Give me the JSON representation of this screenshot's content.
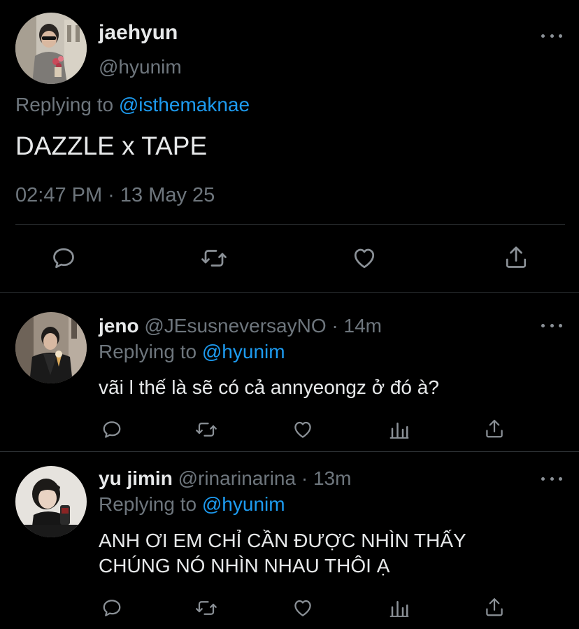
{
  "main_tweet": {
    "display_name": "jaehyun",
    "handle": "@hyunim",
    "replying_prefix": "Replying to",
    "replying_to": "@isthemaknae",
    "text": "DAZZLE x TAPE",
    "timestamp": "02:47 PM · 13 May 25",
    "actions": [
      "reply-icon",
      "retweet-icon",
      "like-icon",
      "share-icon"
    ]
  },
  "replies": [
    {
      "display_name": "jeno",
      "handle": "@JEsusneversayNO",
      "time": "· 14m",
      "replying_prefix": "Replying to",
      "replying_to": "@hyunim",
      "text_lines": [
        "vãi l thế là sẽ có cả annyeongz ở đó à?"
      ],
      "actions": [
        "reply-icon",
        "retweet-icon",
        "like-icon",
        "analytics-icon",
        "share-icon"
      ]
    },
    {
      "display_name": "yu jimin",
      "handle": "@rinarinarina",
      "time": "· 13m",
      "replying_prefix": "Replying to",
      "replying_to": "@hyunim",
      "text_lines": [
        "ANH ƠI EM CHỈ CẦN ĐƯỢC NHÌN THẤY",
        "CHÚNG NÓ NHÌN NHAU THÔI Ạ"
      ],
      "actions": [
        "reply-icon",
        "retweet-icon",
        "like-icon",
        "analytics-icon",
        "share-icon"
      ]
    }
  ],
  "colors": {
    "background": "#000000",
    "text": "#e7e9ea",
    "secondary": "#6e767d",
    "accent": "#1d9bf0",
    "divider": "#2f3336"
  }
}
